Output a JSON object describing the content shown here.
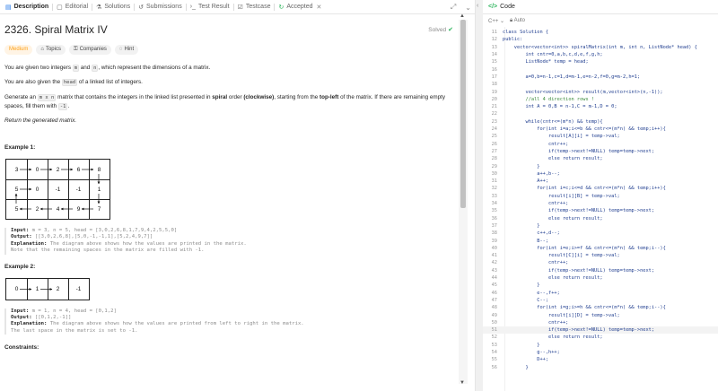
{
  "tabs": [
    {
      "label": "Description",
      "icon": "description-icon",
      "active": true
    },
    {
      "label": "Editorial",
      "icon": "editorial-icon"
    },
    {
      "label": "Solutions",
      "icon": "solutions-icon"
    },
    {
      "label": "Submissions",
      "icon": "submissions-icon"
    },
    {
      "label": "Test Result",
      "icon": "test-result-icon"
    },
    {
      "label": "Testcase",
      "icon": "testcase-icon"
    },
    {
      "label": "Accepted",
      "icon": "accepted-icon"
    }
  ],
  "problem": {
    "title": "2326. Spiral Matrix IV",
    "solved_label": "Solved",
    "difficulty": "Medium",
    "chips": {
      "topics": "Topics",
      "companies": "Companies",
      "hint": "Hint"
    },
    "p1": {
      "a": "You are given two integers ",
      "m": "m",
      "b": " and ",
      "n": "n",
      "c": ", which represent the dimensions of a matrix."
    },
    "p2": {
      "a": "You are also given the ",
      "head": "head",
      "b": " of a linked list of integers."
    },
    "p3": {
      "a": "Generate an ",
      "mxn": "m x n",
      "b": " matrix that contains the integers in the linked list presented in ",
      "spiral": "spiral",
      "c": " order ",
      "cw": "(clockwise)",
      "d": ", starting from the ",
      "topleft": "top-left",
      "e": " of the matrix. If there are remaining empty spaces, fill them with ",
      "neg": "-1",
      "f": "."
    },
    "p4": "Return the generated matrix.",
    "example1": {
      "title": "Example 1:",
      "rows": [
        [
          "3",
          "0",
          "2",
          "6",
          "8"
        ],
        [
          "5",
          "0",
          "-1",
          "-1",
          "1"
        ],
        [
          "5",
          "2",
          "4",
          "9",
          "7"
        ]
      ],
      "input_label": "Input:",
      "input": " m = 3, n = 5, head = [3,0,2,6,8,1,7,9,4,2,5,5,0]",
      "output_label": "Output:",
      "output": " [[3,0,2,6,8],[5,0,-1,-1,1],[5,2,4,9,7]]",
      "explanation_label": "Explanation:",
      "explanation": " The diagram above shows how the values are printed in the matrix.",
      "note": "Note that the remaining spaces in the matrix are filled with -1."
    },
    "example2": {
      "title": "Example 2:",
      "row": [
        "0",
        "1",
        "2",
        "-1"
      ],
      "input_label": "Input:",
      "input": " m = 1, n = 4, head = [0,1,2]",
      "output_label": "Output:",
      "output": " [[0,1,2,-1]]",
      "explanation_label": "Explanation:",
      "explanation": " The diagram above shows how the values are printed from left to right in the matrix.",
      "note": "The last space in the matrix is set to -1."
    },
    "constraints": "Constraints:"
  },
  "editor": {
    "header": "Code",
    "header_tag": "</>",
    "language": "C++",
    "mode": "Auto",
    "lines": [
      {
        "n": 11,
        "t": "class Solution {"
      },
      {
        "n": 12,
        "t": "public:"
      },
      {
        "n": 13,
        "t": "    vector<vector<int>> spiralMatrix(int m, int n, ListNode* head) {"
      },
      {
        "n": 14,
        "t": "        int cntr=0,a,b,c,d,e,f,g,h;"
      },
      {
        "n": 15,
        "t": "        ListNode* temp = head;"
      },
      {
        "n": 16,
        "t": ""
      },
      {
        "n": 17,
        "t": "        a=0,b=n-1,c=1,d=m-1,e=n-2,f=0,g=m-2,h=1;"
      },
      {
        "n": 18,
        "t": ""
      },
      {
        "n": 19,
        "t": "        vector<vector<int>> result(m,vector<int>(n,-1));"
      },
      {
        "n": 20,
        "t": "        //all 4 direction rows !",
        "cm": true
      },
      {
        "n": 21,
        "t": "        int A = 0,B = n-1,C = m-1,D = 0;"
      },
      {
        "n": 22,
        "t": ""
      },
      {
        "n": 23,
        "t": "        while(cntr<=(m*n) && temp){"
      },
      {
        "n": 24,
        "t": "            for(int i=a;i<=b && cntr<=(m*n) && temp;i++){"
      },
      {
        "n": 25,
        "t": "                result[A][i] = temp->val;"
      },
      {
        "n": 26,
        "t": "                cntr++;"
      },
      {
        "n": 27,
        "t": "                if(temp->next!=NULL) temp=temp->next;"
      },
      {
        "n": 28,
        "t": "                else return result;"
      },
      {
        "n": 29,
        "t": "            }"
      },
      {
        "n": 30,
        "t": "            a++,b--;"
      },
      {
        "n": 31,
        "t": "            A++;"
      },
      {
        "n": 32,
        "t": "            for(int i=c;i<=d && cntr<=(m*n) && temp;i++){"
      },
      {
        "n": 33,
        "t": "                result[i][B] = temp->val;"
      },
      {
        "n": 34,
        "t": "                cntr++;"
      },
      {
        "n": 35,
        "t": "                if(temp->next!=NULL) temp=temp->next;"
      },
      {
        "n": 36,
        "t": "                else return result;"
      },
      {
        "n": 37,
        "t": "            }"
      },
      {
        "n": 38,
        "t": "            c++,d--;"
      },
      {
        "n": 39,
        "t": "            B--;"
      },
      {
        "n": 40,
        "t": "            for(int i=e;i>=f && cntr<=(m*n) && temp;i--){"
      },
      {
        "n": 41,
        "t": "                result[C][i] = temp->val;"
      },
      {
        "n": 42,
        "t": "                cntr++;"
      },
      {
        "n": 43,
        "t": "                if(temp->next!=NULL) temp=temp->next;"
      },
      {
        "n": 44,
        "t": "                else return result;"
      },
      {
        "n": 45,
        "t": "            }"
      },
      {
        "n": 46,
        "t": "            e--,f++;"
      },
      {
        "n": 47,
        "t": "            C--;"
      },
      {
        "n": 48,
        "t": "            for(int i=g;i>=h && cntr<=(m*n) && temp;i--){"
      },
      {
        "n": 49,
        "t": "                result[i][D] = temp->val;"
      },
      {
        "n": 50,
        "t": "                cntr++;"
      },
      {
        "n": 51,
        "t": "                if(temp->next!=NULL) temp=temp->next;",
        "hl": true
      },
      {
        "n": 52,
        "t": "                else return result;"
      },
      {
        "n": 53,
        "t": "            }"
      },
      {
        "n": 54,
        "t": "            g--,h++;"
      },
      {
        "n": 55,
        "t": "            D++;"
      },
      {
        "n": 56,
        "t": "        }"
      }
    ]
  }
}
